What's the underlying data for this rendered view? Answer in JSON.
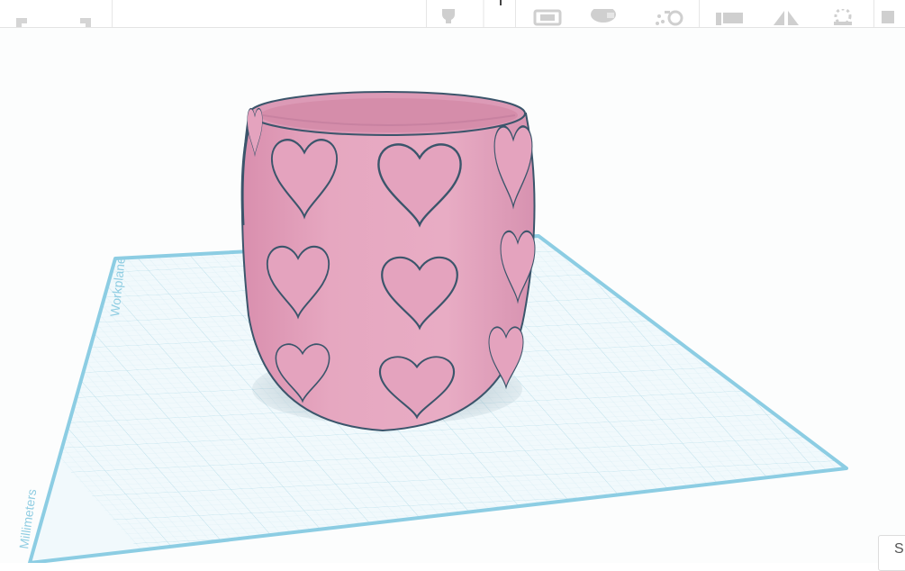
{
  "toolbar": {
    "buttons": [
      {
        "name": "undo-button",
        "icon": "undo-arrow-icon"
      },
      {
        "name": "redo-button",
        "icon": "redo-arrow-icon"
      },
      {
        "name": "light-button",
        "icon": "lightbulb-icon"
      },
      {
        "name": "light-dropdown",
        "icon": "chevron-down-icon"
      },
      {
        "name": "note-button",
        "icon": "note-icon"
      },
      {
        "name": "view-button",
        "icon": "eye-icon"
      },
      {
        "name": "shape-generator-button",
        "icon": "sparkle-icon"
      },
      {
        "name": "align-button",
        "icon": "align-icon"
      },
      {
        "name": "mirror-button",
        "icon": "mirror-icon"
      },
      {
        "name": "group-button",
        "icon": "group-icon"
      },
      {
        "name": "more-button",
        "icon": "shapes-icon"
      }
    ]
  },
  "workplane": {
    "label": "Workplane",
    "units_label": "Millimeters",
    "grid_color": "#bfe3ee",
    "edge_color": "#8ccde3"
  },
  "object": {
    "name": "heart cup",
    "color": "#e4a2bd",
    "outline_color": "#3b556b"
  },
  "corner_panel": {
    "label": "S"
  }
}
